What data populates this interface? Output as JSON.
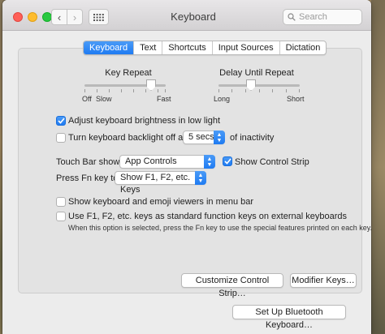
{
  "window": {
    "title": "Keyboard",
    "search_placeholder": "Search",
    "back_glyph": "‹",
    "forward_glyph": "›"
  },
  "tabs": [
    {
      "label": "Keyboard",
      "active": true
    },
    {
      "label": "Text",
      "active": false
    },
    {
      "label": "Shortcuts",
      "active": false
    },
    {
      "label": "Input Sources",
      "active": false
    },
    {
      "label": "Dictation",
      "active": false
    }
  ],
  "key_repeat": {
    "label": "Key Repeat",
    "min_label": "Off",
    "slow_label": "Slow",
    "max_label": "Fast",
    "value_fraction": 0.82
  },
  "delay_until_repeat": {
    "label": "Delay Until Repeat",
    "min_label": "Long",
    "max_label": "Short",
    "value_fraction": 0.4
  },
  "options": {
    "adjust_brightness": {
      "label": "Adjust keyboard brightness in low light",
      "checked": true
    },
    "backlight_off": {
      "label": "Turn keyboard backlight off after",
      "checked": false,
      "suffix": "of inactivity"
    },
    "show_control_strip": {
      "label": "Show Control Strip",
      "checked": true
    },
    "show_viewers": {
      "label": "Show keyboard and emoji viewers in menu bar",
      "checked": false
    },
    "use_fkeys": {
      "label": "Use F1, F2, etc. keys as standard function keys on external keyboards",
      "checked": false,
      "note": "When this option is selected, press the Fn key to use the special features printed on each key."
    }
  },
  "backlight_timeout": {
    "selected": "5 secs"
  },
  "touch_bar": {
    "label": "Touch Bar shows",
    "selected": "App Controls"
  },
  "fn_key": {
    "label": "Press Fn key to",
    "selected": "Show F1, F2, etc. Keys"
  },
  "buttons": {
    "customize": "Customize Control Strip…",
    "modifier": "Modifier Keys…",
    "bluetooth": "Set Up Bluetooth Keyboard…"
  },
  "icons": {
    "search": "search-icon",
    "grid": "grid-icon",
    "checkmark": "checkmark-icon",
    "popup_arrows": "updown-chevron-icon"
  },
  "colors": {
    "accent": "#1f7bf2",
    "close": "#ff5f57",
    "minimize": "#febc2e",
    "zoom": "#28c840"
  }
}
